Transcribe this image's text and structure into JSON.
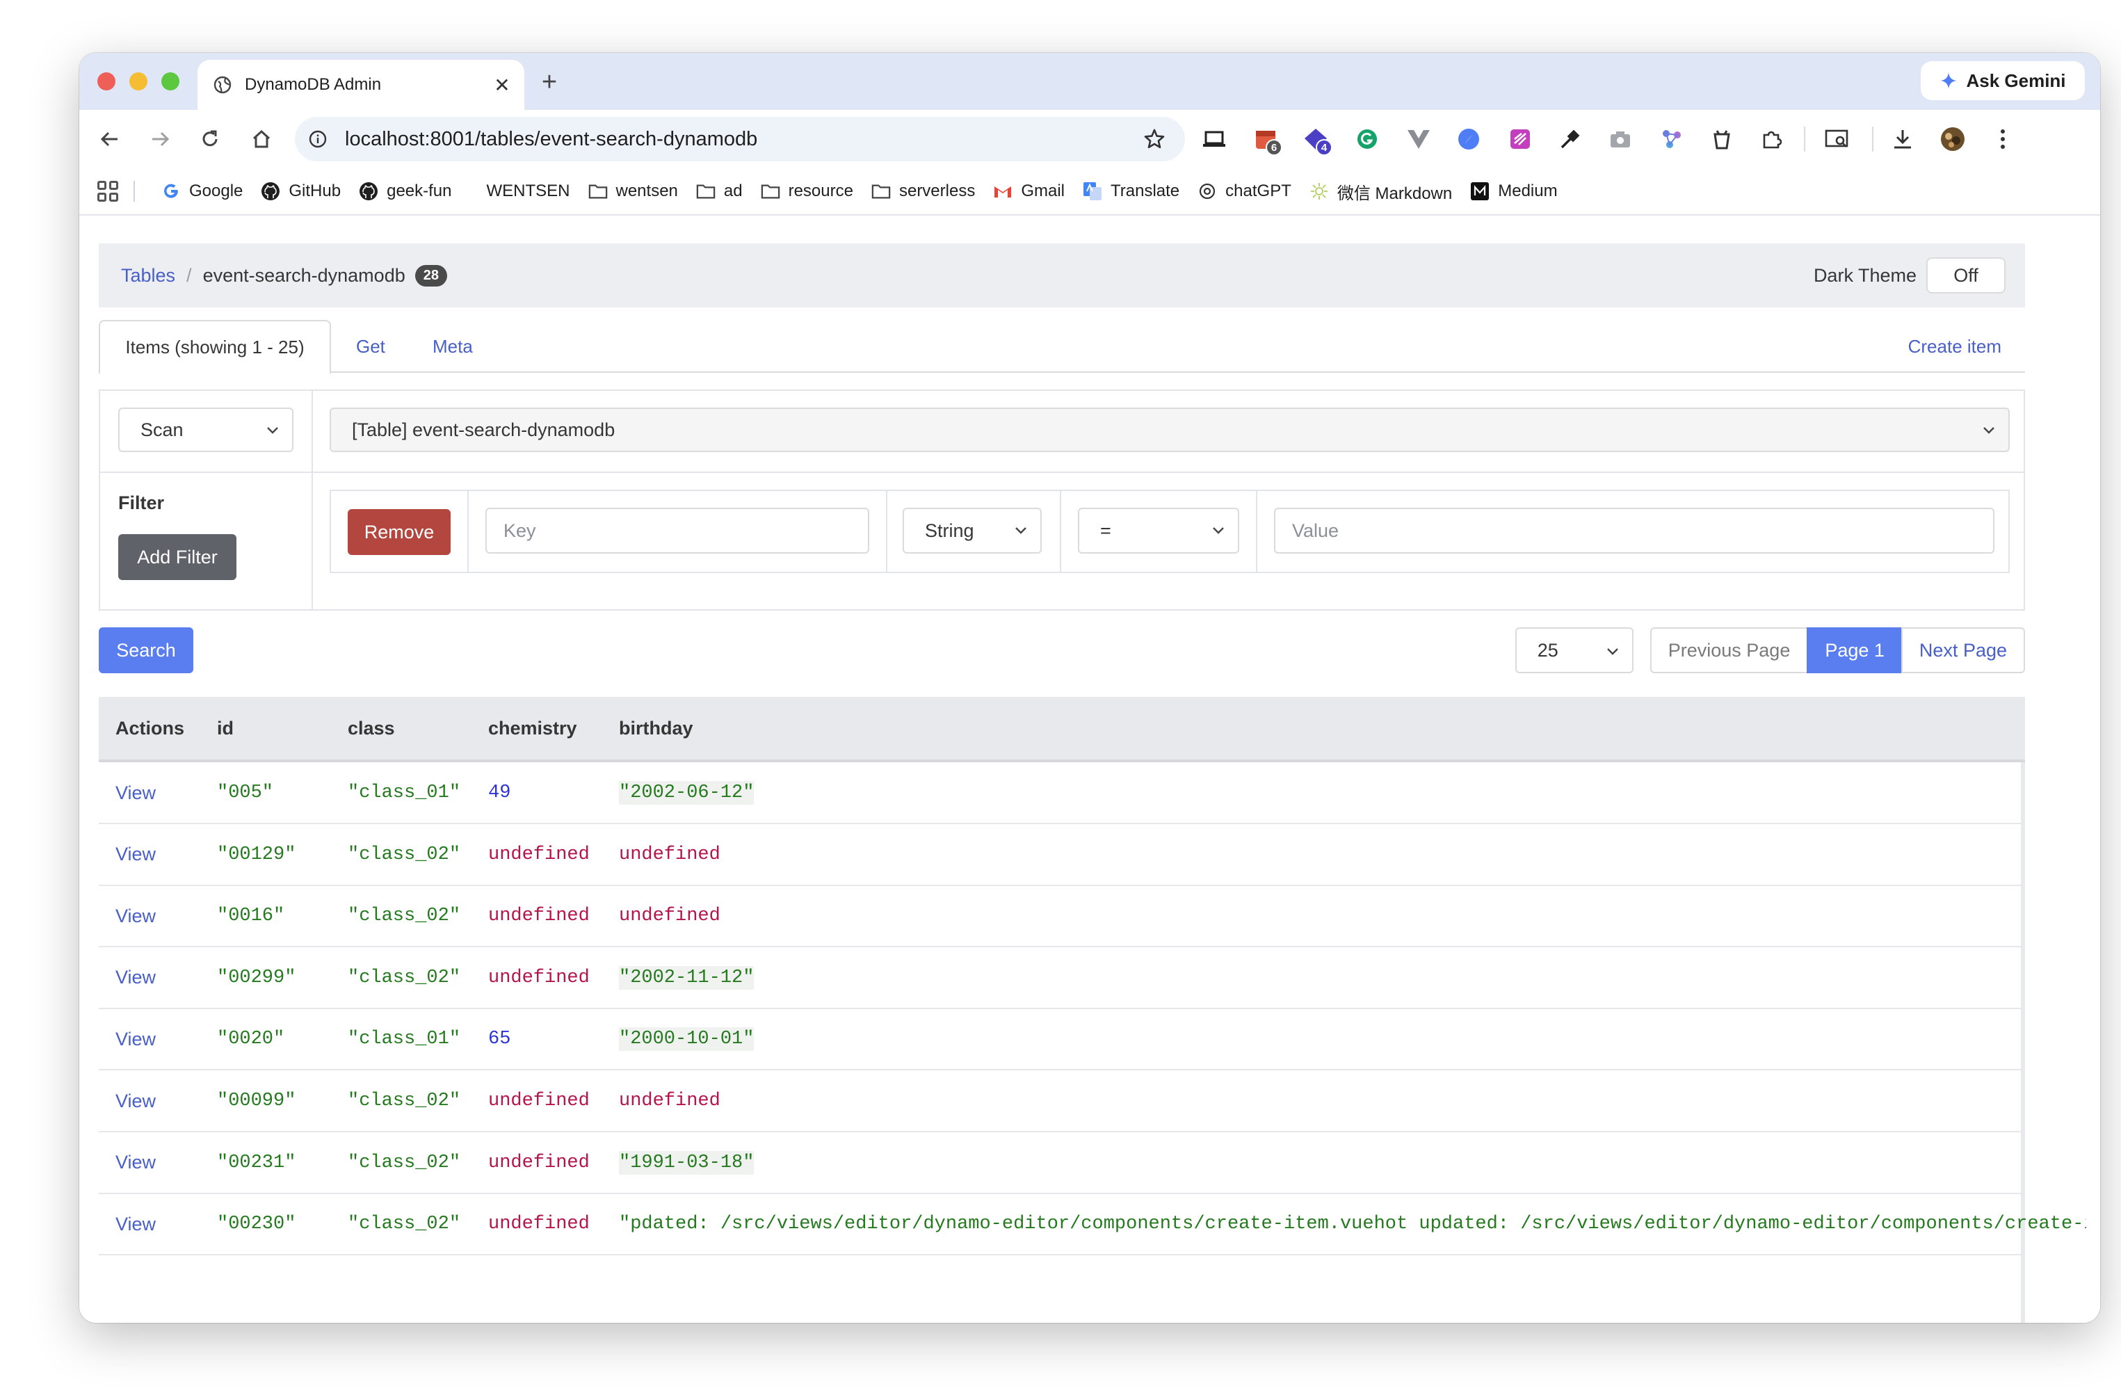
{
  "browser": {
    "tab_title": "DynamoDB Admin",
    "tab_close": "✕",
    "new_tab": "+",
    "ask_gemini": "Ask Gemini",
    "url": "localhost:8001/tables/event-search-dynamodb",
    "extension_badges": {
      "calendar": "6",
      "gem": "4"
    },
    "bookmarks": [
      "Google",
      "GitHub",
      "geek-fun",
      "WENTSEN",
      "wentsen",
      "ad",
      "resource",
      "serverless",
      "Gmail",
      "Translate",
      "chatGPT",
      "微信 Markdown",
      "Medium"
    ]
  },
  "header": {
    "breadcrumb_root": "Tables",
    "breadcrumb_sep": "/",
    "table_name": "event-search-dynamodb",
    "item_count": "28",
    "dark_theme_label": "Dark Theme",
    "dark_theme_value": "Off"
  },
  "tabs": {
    "items": "Items (showing 1 - 25)",
    "get": "Get",
    "meta": "Meta",
    "create_item": "Create item"
  },
  "query": {
    "operation": "Scan",
    "index": "[Table] event-search-dynamodb",
    "filter_label": "Filter",
    "add_filter": "Add Filter",
    "remove": "Remove",
    "key_placeholder": "Key",
    "type": "String",
    "operator": "=",
    "value_placeholder": "Value"
  },
  "controls": {
    "search": "Search",
    "page_size": "25",
    "previous_page": "Previous Page",
    "current_page": "Page 1",
    "next_page": "Next Page"
  },
  "table": {
    "columns": [
      "Actions",
      "id",
      "class",
      "chemistry",
      "birthday"
    ],
    "action_label": "View",
    "rows": [
      {
        "id": "\"005\"",
        "class": "\"class_01\"",
        "chemistry": "49",
        "birthday": "\"2002-06-12\""
      },
      {
        "id": "\"00129\"",
        "class": "\"class_02\"",
        "chemistry": "undefined",
        "birthday": "undefined"
      },
      {
        "id": "\"0016\"",
        "class": "\"class_02\"",
        "chemistry": "undefined",
        "birthday": "undefined"
      },
      {
        "id": "\"00299\"",
        "class": "\"class_02\"",
        "chemistry": "undefined",
        "birthday": "\"2002-11-12\""
      },
      {
        "id": "\"0020\"",
        "class": "\"class_01\"",
        "chemistry": "65",
        "birthday": "\"2000-10-01\""
      },
      {
        "id": "\"00099\"",
        "class": "\"class_02\"",
        "chemistry": "undefined",
        "birthday": "undefined"
      },
      {
        "id": "\"00231\"",
        "class": "\"class_02\"",
        "chemistry": "undefined",
        "birthday": "\"1991-03-18\""
      },
      {
        "id": "\"00230\"",
        "class": "\"class_02\"",
        "chemistry": "undefined",
        "birthday": "\"pdated: /src/views/editor/dynamo-editor/components/create-item.vuehot updated: /src/views/editor/dynamo-editor/components/create-item.vue\""
      }
    ]
  },
  "colors": {
    "link": "#485fc7",
    "primary": "#5a7df0",
    "danger": "#b3473f",
    "string": "#257a1f",
    "number": "#2c33d8",
    "undefined": "#b5154b"
  }
}
